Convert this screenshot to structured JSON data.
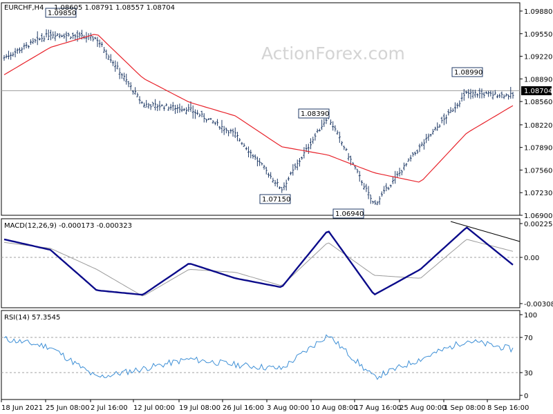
{
  "header": {
    "symbol_label": "EURCHF,H4",
    "ohlc_text": "1.08605 1.08791 1.08557 1.08704",
    "watermark": "ActionForex.com"
  },
  "price_axis": {
    "ticks": [
      "1.09880",
      "1.09550",
      "1.09220",
      "1.08890",
      "1.08560",
      "1.08220",
      "1.07890",
      "1.07560",
      "1.07230",
      "1.06900"
    ],
    "current_label": "1.08704"
  },
  "time_axis": {
    "labels": [
      "18 Jun 2021",
      "25 Jun 08:00",
      "2 Jul 16:00",
      "12 Jul 00:00",
      "19 Jul 08:00",
      "26 Jul 16:00",
      "3 Aug 00:00",
      "10 Aug 08:00",
      "17 Aug 16:00",
      "25 Aug 00:00",
      "1 Sep 08:00",
      "8 Sep 16:00"
    ]
  },
  "annotations": [
    "1.09850",
    "1.08390",
    "1.07150",
    "1.06940",
    "1.08990"
  ],
  "macd": {
    "header": "MACD(12,26,9) -0.000173 -0.000323",
    "ticks": [
      "0.002254",
      "0.00",
      "-0.003088"
    ]
  },
  "rsi": {
    "header": "RSI(14) 57.3545",
    "ticks": [
      "100",
      "70",
      "30",
      "0"
    ]
  },
  "colors": {
    "price_bars": "#1f3a66",
    "moving_average": "#e8222a",
    "macd_line": "#0b0b8a",
    "macd_signal": "#9a9a9a",
    "rsi_line": "#3d8fd6",
    "trendline": "#000000",
    "current_price_line": "#a0a0a0"
  },
  "chart_data": [
    {
      "type": "line",
      "title": "EURCHF,H4",
      "ylim": [
        1.069,
        1.0988
      ],
      "x": [
        "18 Jun 2021",
        "25 Jun 08:00",
        "2 Jul 16:00",
        "12 Jul 00:00",
        "19 Jul 08:00",
        "26 Jul 16:00",
        "3 Aug 00:00",
        "10 Aug 08:00",
        "17 Aug 16:00",
        "25 Aug 00:00",
        "1 Sep 08:00",
        "8 Sep 16:00"
      ],
      "series": [
        {
          "values": [
            1.092,
            1.0955,
            1.0948,
            1.0852,
            1.0845,
            1.0808,
            1.0728,
            1.0835,
            1.0705,
            1.079,
            1.0868,
            1.0865
          ]
        },
        {
          "values": [
            1.0895,
            1.0935,
            1.0955,
            1.089,
            1.0855,
            1.0835,
            1.079,
            1.0778,
            1.0752,
            1.0738,
            1.081,
            1.085
          ]
        }
      ],
      "current": 1.08704,
      "annotations": [
        1.0985,
        1.0839,
        1.0715,
        1.0694,
        1.0899
      ]
    },
    {
      "type": "line",
      "title": "MACD(12,26,9) -0.000173 -0.000323",
      "ylim": [
        -0.003088,
        0.002254
      ],
      "x": [
        "18 Jun 2021",
        "25 Jun 08:00",
        "2 Jul 16:00",
        "12 Jul 00:00",
        "19 Jul 08:00",
        "26 Jul 16:00",
        "3 Aug 00:00",
        "10 Aug 08:00",
        "17 Aug 16:00",
        "25 Aug 00:00",
        "1 Sep 08:00",
        "8 Sep 16:00"
      ],
      "series": [
        {
          "values": [
            0.0012,
            0.0005,
            -0.0022,
            -0.0025,
            -0.0004,
            -0.0014,
            -0.002,
            0.0018,
            -0.0025,
            -0.0008,
            0.002,
            -0.0005
          ]
        },
        {
          "values": [
            0.001,
            0.0006,
            -0.0008,
            -0.0026,
            -0.0008,
            -0.001,
            -0.0019,
            0.001,
            -0.0012,
            -0.0014,
            0.0012,
            0.0004
          ]
        }
      ]
    },
    {
      "type": "line",
      "title": "RSI(14) 57.3545",
      "ylim": [
        0,
        100
      ],
      "x": [
        "18 Jun 2021",
        "25 Jun 08:00",
        "2 Jul 16:00",
        "12 Jul 00:00",
        "19 Jul 08:00",
        "26 Jul 16:00",
        "3 Aug 00:00",
        "10 Aug 08:00",
        "17 Aug 16:00",
        "25 Aug 00:00",
        "1 Sep 08:00",
        "8 Sep 16:00"
      ],
      "series": [
        {
          "values": [
            70,
            60,
            22,
            33,
            45,
            38,
            33,
            75,
            22,
            45,
            68,
            57
          ]
        }
      ]
    }
  ]
}
